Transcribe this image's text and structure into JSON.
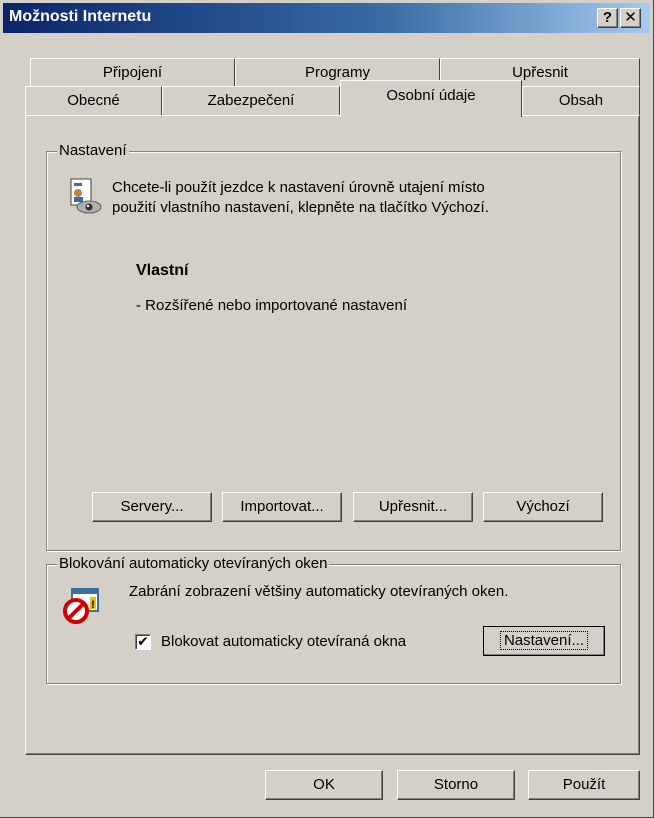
{
  "window": {
    "title": "Možnosti Internetu",
    "help_button": "?",
    "close_button": "✕"
  },
  "tabs": {
    "row_back": [
      "Připojení",
      "Programy",
      "Upřesnit"
    ],
    "row_front": [
      "Obecné",
      "Zabezpečení",
      "Osobní údaje",
      "Obsah"
    ],
    "active": "Osobní údaje"
  },
  "settings_group": {
    "legend": "Nastavení",
    "description_line1": "Chcete-li použít jezdce k nastavení úrovně utajení místo",
    "description_line2": "použití vlastního nastavení, klepněte na tlačítko Výchozí.",
    "level_title": "Vlastní",
    "level_detail": "- Rozšířené nebo importované nastavení",
    "buttons": {
      "servers": "Servery...",
      "import": "Importovat...",
      "advanced": "Upřesnit...",
      "default": "Výchozí"
    }
  },
  "popup_group": {
    "legend": "Blokování automaticky otevíraných oken",
    "description": "Zabrání zobrazení většiny automaticky otevíraných oken.",
    "checkbox_label": "Blokovat automaticky otevíraná okna",
    "checkbox_checked": true,
    "checkbox_mark": "✔",
    "settings_button": "Nastavení..."
  },
  "footer": {
    "ok": "OK",
    "cancel": "Storno",
    "apply": "Použít"
  }
}
